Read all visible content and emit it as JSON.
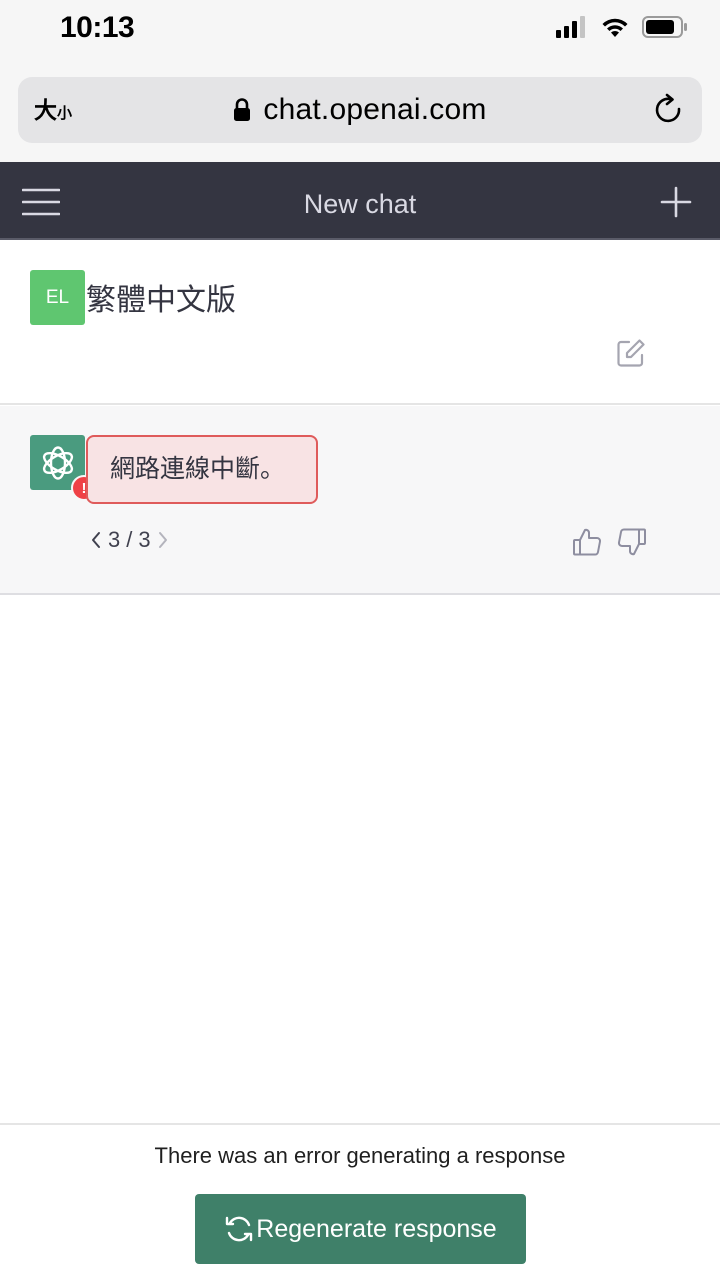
{
  "status_bar": {
    "time": "10:13"
  },
  "browser": {
    "text_size_label_big": "大",
    "text_size_label_small": "小",
    "url": "chat.openai.com"
  },
  "header": {
    "title": "New chat"
  },
  "messages": {
    "user": {
      "avatar_initials": "EL",
      "text": "繁體中文版"
    },
    "assistant": {
      "error_badge": "!",
      "error_text": "網路連線中斷。",
      "pager": {
        "current": "3",
        "separator": "/",
        "total": "3"
      }
    }
  },
  "footer": {
    "error_notice": "There was an error generating a response",
    "regenerate_label": "Regenerate response"
  },
  "colors": {
    "header_bg": "#343541",
    "user_avatar": "#5fc670",
    "bot_avatar": "#4a9b7f",
    "error_red": "#ef4146",
    "regenerate_bg": "#3f8069"
  },
  "icons": [
    "signal-icon",
    "wifi-icon",
    "battery-icon",
    "lock-icon",
    "reload-icon",
    "hamburger-icon",
    "plus-icon",
    "edit-icon",
    "openai-logo-icon",
    "chevron-left-icon",
    "chevron-right-icon",
    "thumbs-up-icon",
    "thumbs-down-icon",
    "refresh-icon"
  ]
}
